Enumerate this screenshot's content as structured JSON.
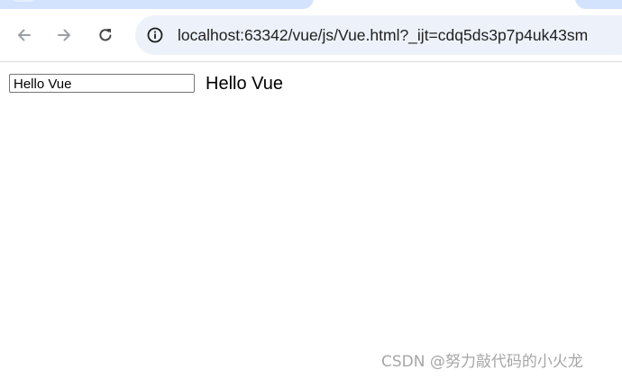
{
  "browser": {
    "address_bar": {
      "url_host": "localhost",
      "url_rest": ":63342/vue/js/Vue.html?_ijt=cdq5ds3p7p4uk43sm"
    },
    "icons": {
      "back": "arrow-left-icon",
      "forward": "arrow-right-icon",
      "reload": "reload-icon",
      "site_info": "info-circle-icon"
    },
    "colors": {
      "tab_active": "#d3e3fd",
      "omnibox_bg": "#edf2fa",
      "icon_disabled": "#9aa0a6",
      "icon_active": "#474747"
    }
  },
  "page": {
    "input_value": "Hello Vue",
    "echo_text": "Hello Vue"
  },
  "watermark": {
    "text": "CSDN @努力敲代码的小火龙"
  }
}
